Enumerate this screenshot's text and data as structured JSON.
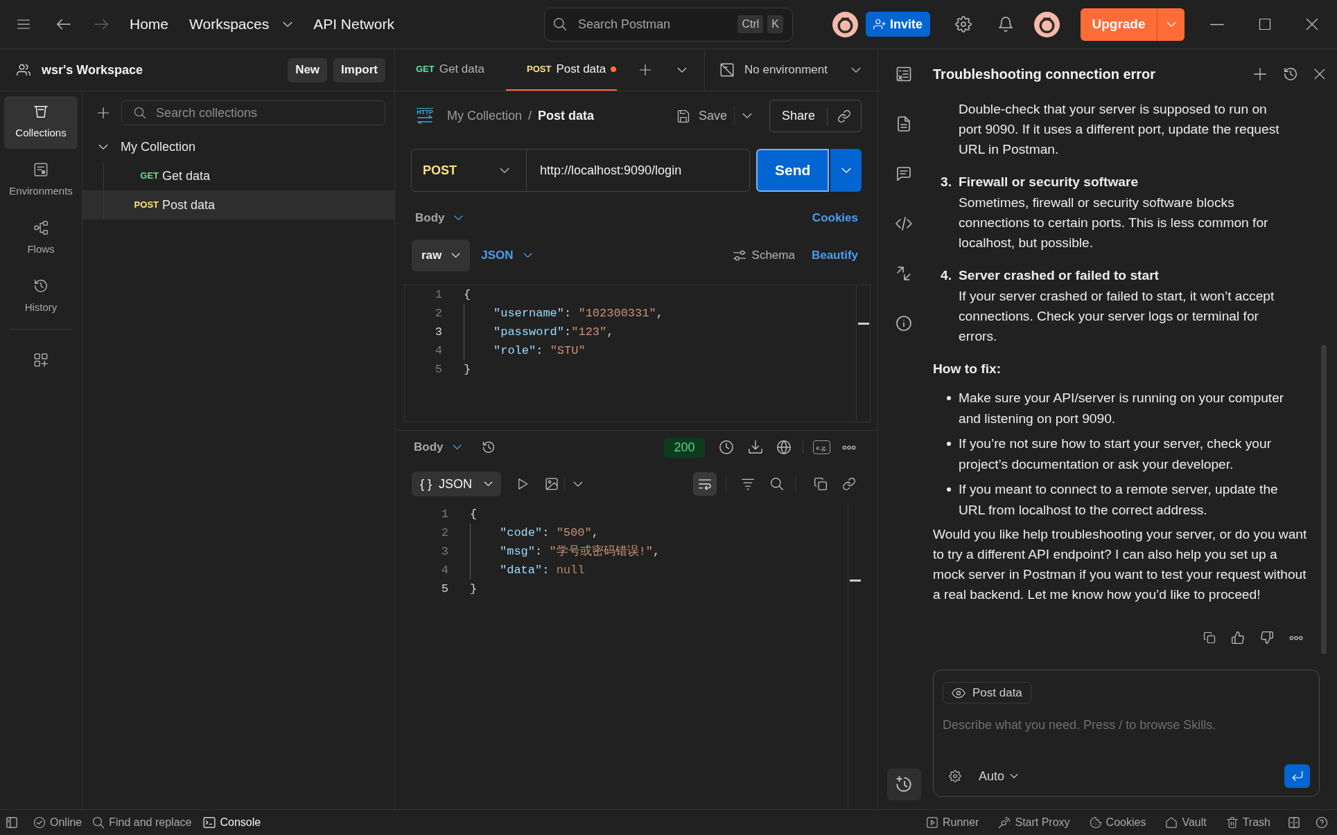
{
  "top_bar": {
    "nav": [
      {
        "label": "Home",
        "dropdown": false
      },
      {
        "label": "Workspaces",
        "dropdown": true
      },
      {
        "label": "API Network",
        "dropdown": false
      }
    ],
    "search": {
      "placeholder": "Search Postman",
      "shortcut": [
        "Ctrl",
        "K"
      ]
    },
    "invite": "Invite",
    "upgrade": "Upgrade"
  },
  "workspace": {
    "name": "wsr's Workspace",
    "buttons": [
      "New",
      "Import"
    ]
  },
  "sidebar": {
    "items": [
      {
        "label": "Collections",
        "selected": true
      },
      {
        "label": "Environments",
        "selected": false
      },
      {
        "label": "Flows",
        "selected": false
      },
      {
        "label": "History",
        "selected": false
      }
    ]
  },
  "collections": {
    "search": {
      "placeholder": "Search collections"
    },
    "tree": [
      {
        "label": "My Collection",
        "expanded": true,
        "children": [
          {
            "method": "GET",
            "color": "#6bdd9a",
            "label": "Get data",
            "selected": false
          },
          {
            "method": "POST",
            "color": "#ffe47e",
            "label": "Post data",
            "selected": true
          }
        ]
      }
    ]
  },
  "tabs": [
    {
      "method": "GET",
      "color": "#6bdd9a",
      "label": "Get data",
      "selected": false,
      "unsaved": false
    },
    {
      "method": "POST",
      "color": "#ffe47e",
      "label": "Post data",
      "selected": true,
      "unsaved": true
    }
  ],
  "environment": {
    "label": "No environment"
  },
  "request": {
    "protocol": "HTTP",
    "breadcrumb": {
      "items": [
        "My Collection",
        "Post data"
      ],
      "separator": "/"
    },
    "save": "Save",
    "share": "Share",
    "method": "POST",
    "url": "http://localhost:9090/login",
    "send": "Send",
    "body_tab": "Body",
    "cookies": "Cookies",
    "body_mode": "raw",
    "body_format": "JSON",
    "schema": "Schema",
    "beautify": "Beautify",
    "code": [
      {
        "number": "1",
        "current": false,
        "indented": false,
        "tokens": [
          {
            "kind": "punct",
            "text": "{"
          }
        ]
      },
      {
        "number": "2",
        "current": false,
        "indented": true,
        "tokens": [
          {
            "kind": "key",
            "text": "\"username\""
          },
          {
            "kind": "punct",
            "text": ": "
          },
          {
            "kind": "string",
            "text": "\"102300331\""
          },
          {
            "kind": "punct",
            "text": ","
          }
        ]
      },
      {
        "number": "3",
        "current": true,
        "indented": true,
        "tokens": [
          {
            "kind": "key",
            "text": "\"password\""
          },
          {
            "kind": "punct",
            "text": ":"
          },
          {
            "kind": "string",
            "text": "\"123\""
          },
          {
            "kind": "punct",
            "text": ","
          }
        ]
      },
      {
        "number": "4",
        "current": false,
        "indented": true,
        "tokens": [
          {
            "kind": "key",
            "text": "\"role\""
          },
          {
            "kind": "punct",
            "text": ": "
          },
          {
            "kind": "string",
            "text": "\"STU\""
          }
        ]
      },
      {
        "number": "5",
        "current": false,
        "indented": false,
        "tokens": [
          {
            "kind": "punct",
            "text": "}"
          }
        ]
      }
    ]
  },
  "response": {
    "body_tab": "Body",
    "status": "200",
    "example_label": "e.g.",
    "format": {
      "glyph": "{ }",
      "label": "JSON"
    },
    "code": [
      {
        "number": "1",
        "current": false,
        "indented": false,
        "tokens": [
          {
            "kind": "punct",
            "text": "{"
          }
        ]
      },
      {
        "number": "2",
        "current": false,
        "indented": true,
        "tokens": [
          {
            "kind": "key",
            "text": "\"code\""
          },
          {
            "kind": "punct",
            "text": ": "
          },
          {
            "kind": "string",
            "text": "\"500\""
          },
          {
            "kind": "punct",
            "text": ","
          }
        ]
      },
      {
        "number": "3",
        "current": false,
        "indented": true,
        "tokens": [
          {
            "kind": "key",
            "text": "\"msg\""
          },
          {
            "kind": "punct",
            "text": ": "
          },
          {
            "kind": "string",
            "text": "\"学号或密码错误!\""
          },
          {
            "kind": "punct",
            "text": ","
          }
        ]
      },
      {
        "number": "4",
        "current": false,
        "indented": true,
        "tokens": [
          {
            "kind": "key",
            "text": "\"data\""
          },
          {
            "kind": "punct",
            "text": ": "
          },
          {
            "kind": "literal",
            "text": "null"
          }
        ]
      },
      {
        "number": "5",
        "current": true,
        "indented": false,
        "tokens": [
          {
            "kind": "punct",
            "text": "}"
          }
        ]
      }
    ]
  },
  "assistant": {
    "title": "Troubleshooting connection error",
    "blocks": [
      {
        "kind": "continuation",
        "text": "Double-check that your server is supposed to run on port 9090. If it uses a different port, update the request URL in Postman."
      },
      {
        "kind": "numbered",
        "number": "3.",
        "title": "Firewall or security software",
        "text": "Sometimes, firewall or security software blocks connections to certain ports. This is less common for localhost, but possible."
      },
      {
        "kind": "numbered",
        "number": "4.",
        "title": "Server crashed or failed to start",
        "text": "If your server crashed or failed to start, it won’t accept connections. Check your server logs or terminal for errors."
      },
      {
        "kind": "heading",
        "text": "How to fix:"
      },
      {
        "kind": "bullets",
        "items": [
          "Make sure your API/server is running on your computer and listening on port 9090.",
          "If you’re not sure how to start your server, check your project’s documentation or ask your developer.",
          "If you meant to connect to a remote server, update the URL from localhost to the correct address."
        ]
      },
      {
        "kind": "paragraph",
        "text": "Would you like help troubleshooting your server, or do you want to try a different API endpoint? I can also help you set up a mock server in Postman if you want to test your request without a real backend. Let me know how you’d like to proceed!"
      }
    ],
    "composer": {
      "context": "Post data",
      "placeholder": "Describe what you need. Press / to browse Skills.",
      "mode": "Auto"
    }
  },
  "status_bar": {
    "left": [
      {
        "label": "Online",
        "selected": false
      },
      {
        "label": "Find and replace",
        "selected": false
      },
      {
        "label": "Console",
        "selected": true
      }
    ],
    "right": [
      {
        "label": "Runner"
      },
      {
        "label": "Start Proxy"
      },
      {
        "label": "Cookies"
      },
      {
        "label": "Vault"
      },
      {
        "label": "Trash"
      }
    ]
  }
}
